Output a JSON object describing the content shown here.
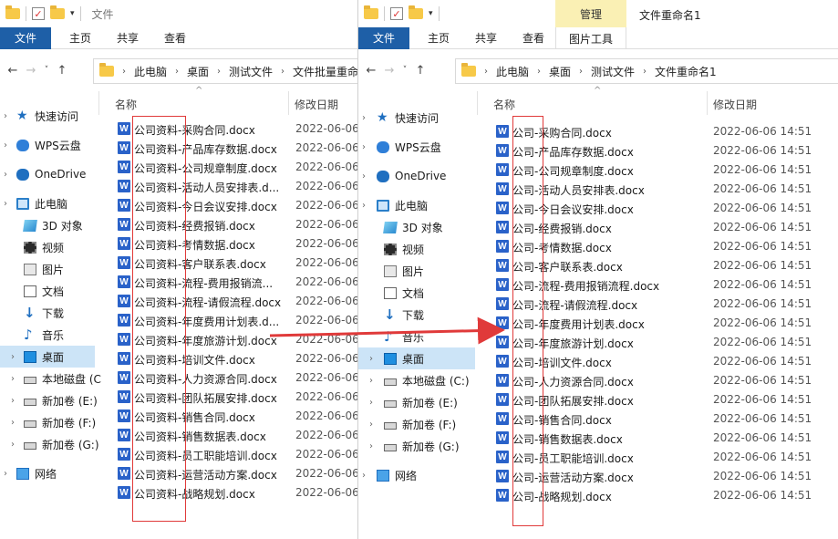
{
  "left": {
    "title": "文件",
    "ribbon_tabs": [
      "文件",
      "主页",
      "共享",
      "查看"
    ],
    "breadcrumb": [
      "此电脑",
      "桌面",
      "测试文件",
      "文件批量重命"
    ],
    "columns": {
      "name": "名称",
      "date": "修改日期"
    },
    "files": [
      {
        "name": "公司资料-采购合同.docx",
        "date": "2022-06-06"
      },
      {
        "name": "公司资料-产品库存数据.docx",
        "date": "2022-06-06"
      },
      {
        "name": "公司资料-公司规章制度.docx",
        "date": "2022-06-06"
      },
      {
        "name": "公司资料-活动人员安排表.d...",
        "date": "2022-06-06"
      },
      {
        "name": "公司资料-今日会议安排.docx",
        "date": "2022-06-06"
      },
      {
        "name": "公司资料-经费报销.docx",
        "date": "2022-06-06"
      },
      {
        "name": "公司资料-考情数据.docx",
        "date": "2022-06-06"
      },
      {
        "name": "公司资料-客户联系表.docx",
        "date": "2022-06-06"
      },
      {
        "name": "公司资料-流程-费用报销流...",
        "date": "2022-06-06"
      },
      {
        "name": "公司资料-流程-请假流程.docx",
        "date": "2022-06-06"
      },
      {
        "name": "公司资料-年度费用计划表.d...",
        "date": "2022-06-06"
      },
      {
        "name": "公司资料-年度旅游计划.docx",
        "date": "2022-06-06"
      },
      {
        "name": "公司资料-培训文件.docx",
        "date": "2022-06-06"
      },
      {
        "name": "公司资料-人力资源合同.docx",
        "date": "2022-06-06"
      },
      {
        "name": "公司资料-团队拓展安排.docx",
        "date": "2022-06-06"
      },
      {
        "name": "公司资料-销售合同.docx",
        "date": "2022-06-06"
      },
      {
        "name": "公司资料-销售数据表.docx",
        "date": "2022-06-06"
      },
      {
        "name": "公司资料-员工职能培训.docx",
        "date": "2022-06-06"
      },
      {
        "name": "公司资料-运营活动方案.docx",
        "date": "2022-06-06"
      },
      {
        "name": "公司资料-战略规划.docx",
        "date": "2022-06-06"
      }
    ]
  },
  "right": {
    "manage_tab": "管理",
    "title": "文件重命名1",
    "ribbon_tabs": [
      "文件",
      "主页",
      "共享",
      "查看"
    ],
    "picture_tools": "图片工具",
    "breadcrumb": [
      "此电脑",
      "桌面",
      "测试文件",
      "文件重命名1"
    ],
    "columns": {
      "name": "名称",
      "date": "修改日期"
    },
    "files": [
      {
        "name": "公司-采购合同.docx",
        "date": "2022-06-06 14:51"
      },
      {
        "name": "公司-产品库存数据.docx",
        "date": "2022-06-06 14:51"
      },
      {
        "name": "公司-公司规章制度.docx",
        "date": "2022-06-06 14:51"
      },
      {
        "name": "公司-活动人员安排表.docx",
        "date": "2022-06-06 14:51"
      },
      {
        "name": "公司-今日会议安排.docx",
        "date": "2022-06-06 14:51"
      },
      {
        "name": "公司-经费报销.docx",
        "date": "2022-06-06 14:51"
      },
      {
        "name": "公司-考情数据.docx",
        "date": "2022-06-06 14:51"
      },
      {
        "name": "公司-客户联系表.docx",
        "date": "2022-06-06 14:51"
      },
      {
        "name": "公司-流程-费用报销流程.docx",
        "date": "2022-06-06 14:51"
      },
      {
        "name": "公司-流程-请假流程.docx",
        "date": "2022-06-06 14:51"
      },
      {
        "name": "公司-年度费用计划表.docx",
        "date": "2022-06-06 14:51"
      },
      {
        "name": "公司-年度旅游计划.docx",
        "date": "2022-06-06 14:51"
      },
      {
        "name": "公司-培训文件.docx",
        "date": "2022-06-06 14:51"
      },
      {
        "name": "公司-人力资源合同.docx",
        "date": "2022-06-06 14:51"
      },
      {
        "name": "公司-团队拓展安排.docx",
        "date": "2022-06-06 14:51"
      },
      {
        "name": "公司-销售合同.docx",
        "date": "2022-06-06 14:51"
      },
      {
        "name": "公司-销售数据表.docx",
        "date": "2022-06-06 14:51"
      },
      {
        "name": "公司-员工职能培训.docx",
        "date": "2022-06-06 14:51"
      },
      {
        "name": "公司-运营活动方案.docx",
        "date": "2022-06-06 14:51"
      },
      {
        "name": "公司-战略规划.docx",
        "date": "2022-06-06 14:51"
      }
    ]
  },
  "sidebar_left": [
    {
      "label": "快速访问",
      "icon": "star-icon"
    },
    {
      "label": "WPS云盘",
      "icon": "cloud-icon"
    },
    {
      "label": "OneDrive",
      "icon": "onedrive-icon"
    },
    {
      "label": "此电脑",
      "icon": "pc-icon"
    },
    {
      "label": "3D 对象",
      "icon": "cube-icon"
    },
    {
      "label": "视频",
      "icon": "video-icon"
    },
    {
      "label": "图片",
      "icon": "picture-icon"
    },
    {
      "label": "文档",
      "icon": "document-icon"
    },
    {
      "label": "下载",
      "icon": "download-icon"
    },
    {
      "label": "音乐",
      "icon": "music-icon"
    },
    {
      "label": "桌面",
      "icon": "desktop-icon"
    },
    {
      "label": "本地磁盘 (C",
      "icon": "disk-icon"
    },
    {
      "label": "新加卷 (E:)",
      "icon": "drive-icon"
    },
    {
      "label": "新加卷 (F:)",
      "icon": "drive-icon"
    },
    {
      "label": "新加卷 (G:)",
      "icon": "drive-icon"
    },
    {
      "label": "网络",
      "icon": "network-icon"
    }
  ],
  "sidebar_right": [
    {
      "label": "快速访问",
      "icon": "star-icon"
    },
    {
      "label": "WPS云盘",
      "icon": "cloud-icon"
    },
    {
      "label": "OneDrive",
      "icon": "onedrive-icon"
    },
    {
      "label": "此电脑",
      "icon": "pc-icon"
    },
    {
      "label": "3D 对象",
      "icon": "cube-icon"
    },
    {
      "label": "视频",
      "icon": "video-icon"
    },
    {
      "label": "图片",
      "icon": "picture-icon"
    },
    {
      "label": "文档",
      "icon": "document-icon"
    },
    {
      "label": "下载",
      "icon": "download-icon"
    },
    {
      "label": "音乐",
      "icon": "music-icon"
    },
    {
      "label": "桌面",
      "icon": "desktop-icon"
    },
    {
      "label": "本地磁盘 (C:)",
      "icon": "disk-icon"
    },
    {
      "label": "新加卷 (E:)",
      "icon": "drive-icon"
    },
    {
      "label": "新加卷 (F:)",
      "icon": "drive-icon"
    },
    {
      "label": "新加卷 (G:)",
      "icon": "drive-icon"
    },
    {
      "label": "网络",
      "icon": "network-icon"
    }
  ],
  "colors": {
    "accent": "#1e5fa7",
    "highlight": "#e03a3a",
    "selected": "#cce4f7",
    "word": "#2a62c9"
  }
}
